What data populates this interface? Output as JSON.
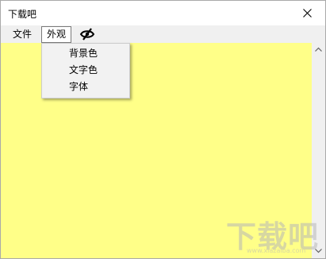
{
  "window": {
    "title": "下载吧"
  },
  "menubar": {
    "items": [
      {
        "label": "文件"
      },
      {
        "label": "外观"
      }
    ],
    "icon": "eye-slash-icon"
  },
  "dropdown": {
    "items": [
      {
        "label": "背景色"
      },
      {
        "label": "文字色"
      },
      {
        "label": "字体"
      }
    ]
  },
  "content": {
    "background_color": "#ffff88"
  },
  "watermark": {
    "text": "下载吧",
    "subtext": "www.xiazaiba.com"
  }
}
